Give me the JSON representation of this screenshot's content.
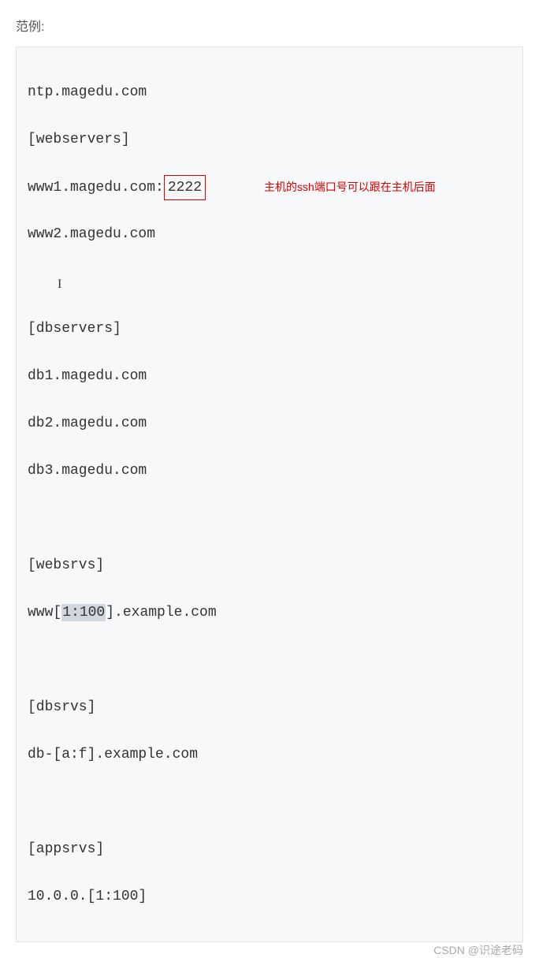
{
  "title": "范例:",
  "code": {
    "line1": "ntp.magedu.com",
    "line2": "[webservers]",
    "line3_prefix": "www1.magedu.com:",
    "line3_port": "2222",
    "line4": "www2.magedu.com",
    "line6": "[dbservers]",
    "line7": "db1.magedu.com",
    "line8": "db2.magedu.com",
    "line9": "db3.magedu.com",
    "line11": "[websrvs]",
    "line12_a": "www[",
    "line12_hl": "1:100",
    "line12_b": "].example.com",
    "line14": "[dbsrvs]",
    "line15": "db-[a:f].example.com",
    "line17": "[appsrvs]",
    "line18": "10.0.0.[1:100]"
  },
  "annotation": "主机的ssh端口号可以跟在主机后面",
  "watermark": "CSDN @识途老码"
}
